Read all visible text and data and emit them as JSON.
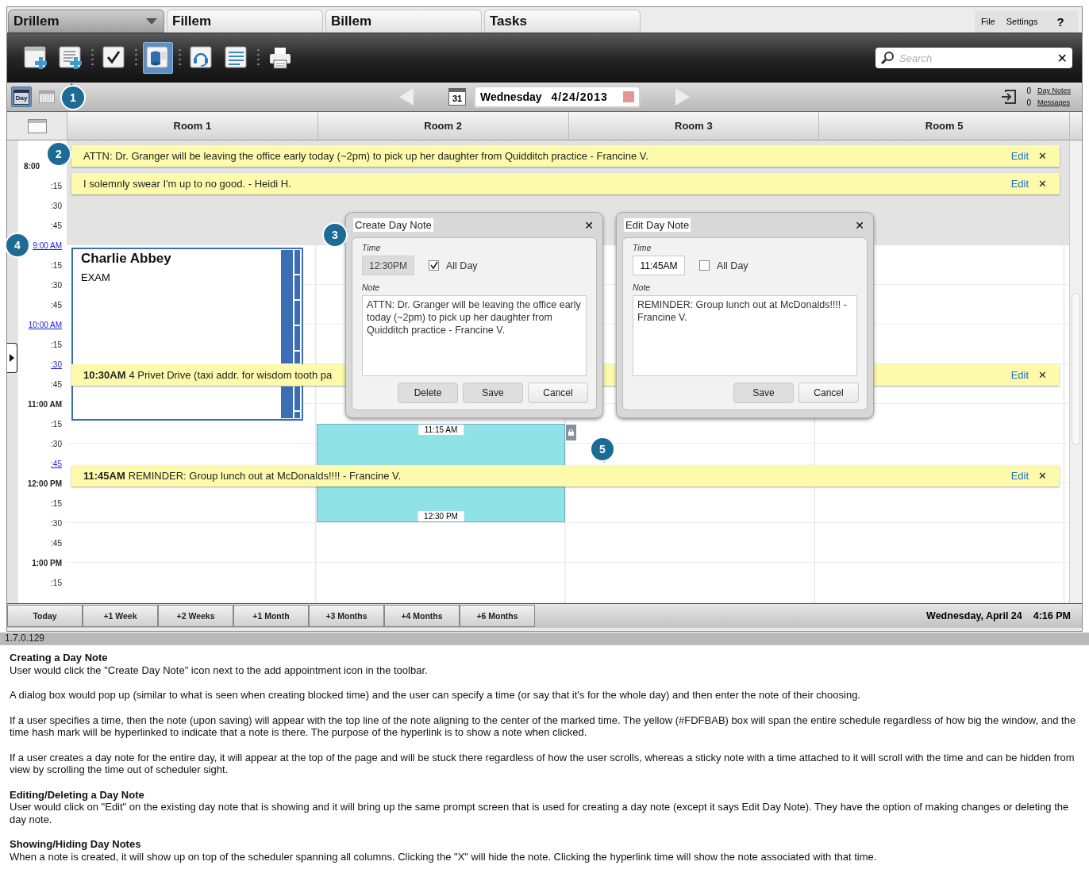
{
  "tabs": [
    {
      "label": "Drillem",
      "selected": true
    },
    {
      "label": "Fillem",
      "selected": false
    },
    {
      "label": "Billem",
      "selected": false
    },
    {
      "label": "Tasks",
      "selected": false
    }
  ],
  "menu": [
    "File",
    "Settings",
    "?"
  ],
  "tools": [
    {
      "kind": "appointment-add",
      "selected": false
    },
    {
      "kind": "note-add",
      "selected": false
    },
    {
      "kind": "check",
      "selected": false
    },
    {
      "kind": "database",
      "selected": true
    },
    {
      "kind": "headset",
      "selected": false
    },
    {
      "kind": "list",
      "selected": false
    },
    {
      "kind": "print",
      "selected": false
    }
  ],
  "search": {
    "placeholder": "Search",
    "clear": "✕"
  },
  "nav": {
    "views": [
      {
        "kind": "day",
        "label": "Day",
        "selected": true
      },
      {
        "kind": "week",
        "selected": false
      }
    ],
    "calendar_day": "31",
    "weekday": "Wednesday",
    "date": "4/24/2013",
    "counters": [
      {
        "count": "0",
        "label": "Day Notes"
      },
      {
        "count": "0",
        "label": "Messages"
      }
    ]
  },
  "rooms": [
    "Room 1",
    "Room 2",
    "Room 3",
    "Room 5"
  ],
  "times": [
    {
      "label": "8:00",
      "kind": "hour"
    },
    {
      "label": ":15",
      "kind": "quarter"
    },
    {
      "label": ":30",
      "kind": "quarter"
    },
    {
      "label": ":45",
      "kind": "quarter"
    },
    {
      "label": "9:00 AM",
      "kind": "link"
    },
    {
      "label": ":15",
      "kind": "quarter"
    },
    {
      "label": ":30",
      "kind": "quarter"
    },
    {
      "label": ":45",
      "kind": "quarter"
    },
    {
      "label": "10:00 AM",
      "kind": "link"
    },
    {
      "label": ":15",
      "kind": "quarter"
    },
    {
      "label": ":30",
      "kind": "link"
    },
    {
      "label": ":45",
      "kind": "quarter"
    },
    {
      "label": "11:00 AM",
      "kind": "hour"
    },
    {
      "label": ":15",
      "kind": "quarter"
    },
    {
      "label": ":30",
      "kind": "quarter"
    },
    {
      "label": ":45",
      "kind": "link"
    },
    {
      "label": "12:00 PM",
      "kind": "hour"
    },
    {
      "label": ":15",
      "kind": "quarter"
    },
    {
      "label": ":30",
      "kind": "quarter"
    },
    {
      "label": ":45",
      "kind": "quarter"
    },
    {
      "label": "1:00 PM",
      "kind": "hour"
    },
    {
      "label": ":15",
      "kind": "quarter"
    }
  ],
  "day_notes": [
    {
      "text": "ATTN: Dr. Granger will be leaving the office early today (~2pm) to pick up her daughter from Quidditch practice - Francine V.",
      "edit": "Edit",
      "close": "✕"
    },
    {
      "text": "I solemnly swear I'm up to no good. - Heidi H.",
      "edit": "Edit",
      "close": "✕"
    },
    {
      "time": "10:30AM",
      "text": "4 Privet Drive (taxi addr. for wisdom tooth pa",
      "edit": "Edit",
      "close": "✕"
    },
    {
      "time": "11:45AM",
      "text": "REMINDER: Group lunch out at McDonalds!!!! - Francine V.",
      "edit": "Edit",
      "close": "✕"
    }
  ],
  "appointment": {
    "name": "Charlie Abbey",
    "type": "EXAM"
  },
  "blocked_time": {
    "start": "11:15 AM",
    "end": "12:30 PM"
  },
  "dialogs": [
    {
      "title": "Create Day Note",
      "close": "✕",
      "time_label": "Time",
      "time": "12:30PM",
      "time_disabled": true,
      "all_day_label": "All Day",
      "all_day": true,
      "note_label": "Note",
      "note": "ATTN: Dr. Granger will be leaving the office early today (~2pm) to pick up her daughter from Quidditch practice - Francine V.",
      "buttons": [
        "Delete",
        "Save",
        "Cancel"
      ]
    },
    {
      "title": "Edit Day Note",
      "close": "✕",
      "time_label": "Time",
      "time": "11:45AM",
      "time_disabled": false,
      "all_day_label": "All Day",
      "all_day": false,
      "note_label": "Note",
      "note": "REMINDER: Group lunch out at McDonalds!!!! - Francine V.",
      "buttons": [
        "Save",
        "Cancel"
      ]
    }
  ],
  "callouts": [
    "1",
    "2",
    "3",
    "4",
    "5"
  ],
  "quick_jumps": [
    "Today",
    "+1 Week",
    "+2 Weeks",
    "+1 Month",
    "+3 Months",
    "+4 Months",
    "+6 Months"
  ],
  "status": {
    "date": "Wednesday, April 24",
    "time": "4:16 PM"
  },
  "version": "1.7.0.129",
  "doc": [
    {
      "heading": "Creating a Day Note",
      "paragraphs": [
        "User would click the \"Create Day Note\" icon next to the add appointment icon in the toolbar.",
        "A dialog box would pop up (similar to what is seen when creating blocked time) and the user can specify a time (or say that it's for the whole day) and then enter the note of their choosing.",
        "If a user specifies a time, then the note (upon saving) will appear with the top line of the note aligning to the center of the marked time. The yellow (#FDFBAB) box will span the entire schedule regardless of how big the window, and the time hash mark will be hyperlinked to indicate that a note is there. The purpose of the hyperlink is to show a note when clicked.",
        "If a user creates a day note for the entire day, it will appear at the top of the page and will be stuck there regardless of how the user scrolls, whereas a sticky note with a time attached to it will scroll with the time and can be hidden from view by scrolling the time out of scheduler sight."
      ]
    },
    {
      "heading": "Editing/Deleting a Day Note",
      "paragraphs": [
        "User would click on \"Edit\" on the existing day note that is showing and it will bring up the same prompt screen that is used for creating a day note (except it says Edit Day Note). They have the option of making changes or deleting the day note."
      ]
    },
    {
      "heading": "Showing/Hiding Day Notes",
      "paragraphs": [
        "When a note is created, it will show up on top of the scheduler spanning all columns. Clicking the \"X\" will hide the note. Clicking the hyperlink time will show the note associated with that time."
      ]
    }
  ]
}
